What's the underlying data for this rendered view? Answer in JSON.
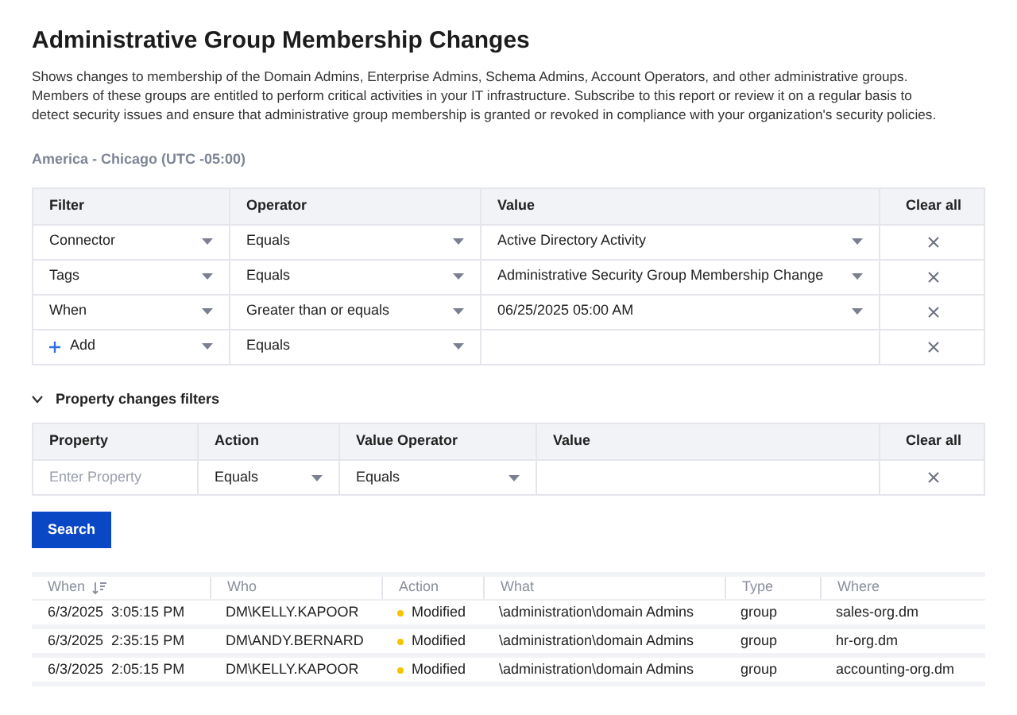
{
  "title": "Administrative Group Membership Changes",
  "description": "Shows changes to membership of the Domain Admins, Enterprise Admins, Schema Admins, Account Operators, and other administrative groups. Members of these groups are entitled to perform critical activities in your IT infrastructure. Subscribe to this report or review it on a regular basis to detect security issues and ensure that administrative group membership is granted or revoked in compliance with your organization's security policies.",
  "timezone": "America - Chicago (UTC -05:00)",
  "filters": {
    "columns": [
      "Filter",
      "Operator",
      "Value",
      "Clear all"
    ],
    "rows": [
      {
        "kind": "filter",
        "filter": "Connector",
        "operator": "Equals",
        "value": "Active Directory Activity"
      },
      {
        "kind": "filter",
        "filter": "Tags",
        "operator": "Equals",
        "value": "Administrative Security Group Membership Change"
      },
      {
        "kind": "filter",
        "filter": "When",
        "operator": "Greater than or equals",
        "value": "06/25/2025   05:00 AM"
      },
      {
        "kind": "add",
        "filter": "Add",
        "operator": "Equals"
      }
    ]
  },
  "property_filters": {
    "title": "Property changes filters",
    "expanded": true,
    "columns": [
      "Property",
      "Action",
      "Value Operator",
      "Value",
      "Clear all"
    ],
    "row": {
      "property_placeholder": "Enter Property",
      "action": "Equals",
      "value_operator": "Equals"
    }
  },
  "search_button": "Search",
  "results": {
    "columns": [
      "When",
      "Who",
      "Action",
      "What",
      "Type",
      "Where"
    ],
    "rows": [
      {
        "when": "6/3/2025  3:05:15 PM",
        "who": "DM\\KELLY.KAPOOR",
        "action": "Modified",
        "color": "#f5c400",
        "what": "\\administration\\domain Admins",
        "type": "group",
        "where": "sales-org.dm"
      },
      {
        "when": "6/3/2025  2:35:15 PM",
        "who": "DM\\ANDY.BERNARD",
        "action": "Modified",
        "color": "#f5c400",
        "what": "\\administration\\domain Admins",
        "type": "group",
        "where": "hr-org.dm"
      },
      {
        "when": "6/3/2025  2:05:15 PM",
        "who": "DM\\KELLY.KAPOOR",
        "action": "Modified",
        "color": "#f5c400",
        "what": "\\administration\\domain Admins",
        "type": "group",
        "where": "accounting-org.dm"
      }
    ]
  }
}
